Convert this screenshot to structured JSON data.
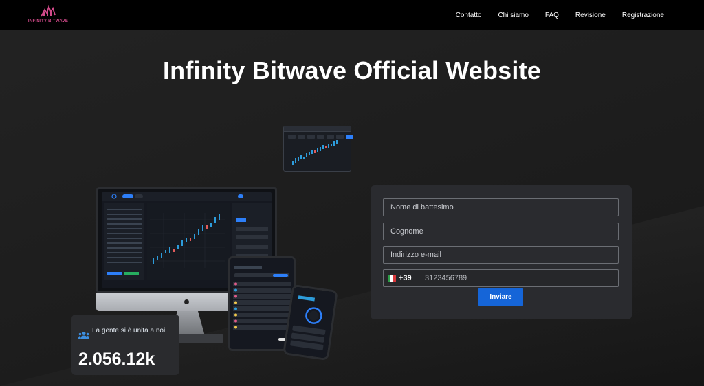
{
  "brand": {
    "name": "INFINITY BITWAVE",
    "color": "#d24a8a"
  },
  "nav": {
    "items": [
      "Contatto",
      "Chi siamo",
      "FAQ",
      "Revisione",
      "Registrazione"
    ]
  },
  "hero": {
    "title": "Infinity Bitwave Official Website"
  },
  "stats": {
    "label": "La gente si è unita a noi",
    "value": "2.056.12k"
  },
  "form": {
    "first_name_placeholder": "Nome di battesimo",
    "last_name_placeholder": "Cognome",
    "email_placeholder": "Indirizzo e-mail",
    "phone_code": "+39",
    "phone_placeholder": "3123456789",
    "submit_label": "Inviare",
    "accent": "#1565d8"
  },
  "icons": {
    "users": "users-icon",
    "flag": "italy-flag-icon"
  }
}
